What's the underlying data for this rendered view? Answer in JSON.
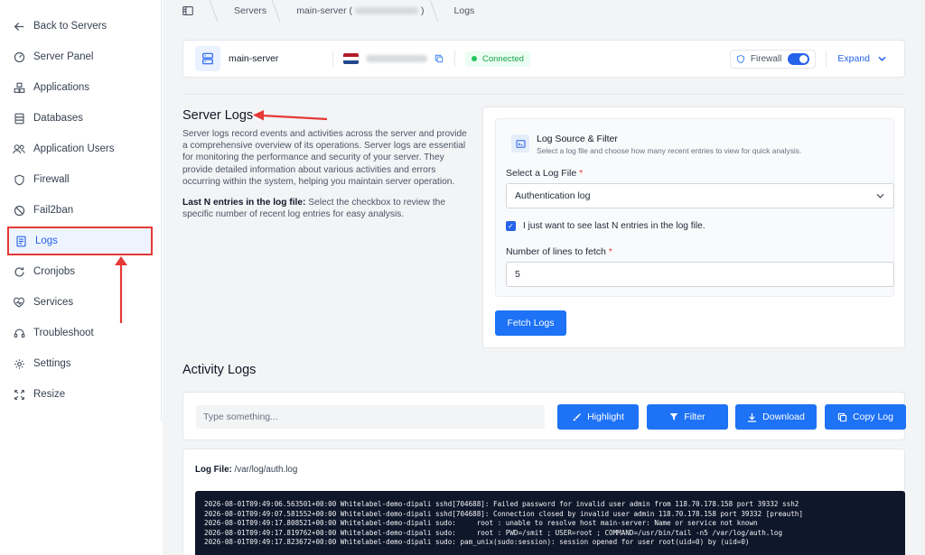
{
  "sidebar": {
    "back_label": "Back to Servers",
    "items": [
      {
        "label": "Server Panel",
        "icon": "gauge-icon"
      },
      {
        "label": "Applications",
        "icon": "applications-icon"
      },
      {
        "label": "Databases",
        "icon": "database-icon"
      },
      {
        "label": "Application Users",
        "icon": "users-icon"
      },
      {
        "label": "Firewall",
        "icon": "shield-icon"
      },
      {
        "label": "Fail2ban",
        "icon": "ban-icon"
      },
      {
        "label": "Logs",
        "icon": "logs-icon",
        "active": true
      },
      {
        "label": "Cronjobs",
        "icon": "refresh-icon"
      },
      {
        "label": "Services",
        "icon": "services-icon"
      },
      {
        "label": "Troubleshoot",
        "icon": "headset-icon"
      },
      {
        "label": "Settings",
        "icon": "gear-icon"
      },
      {
        "label": "Resize",
        "icon": "resize-icon"
      }
    ]
  },
  "breadcrumb": {
    "servers": "Servers",
    "server": "main-server (",
    "server_suffix": ")",
    "current": "Logs"
  },
  "server": {
    "name": "main-server",
    "status": "Connected",
    "firewall_label": "Firewall",
    "firewall_on": true,
    "expand_label": "Expand"
  },
  "intro": {
    "title": "Server Logs",
    "description": "Server logs record events and activities across the server and provide a comprehensive overview of its operations. Server logs are essential for monitoring the performance and security of your server. They provide detailed information about various activities and errors occurring within the system, helping you maintain server operation.",
    "lastn_title": "Last N entries in the log file:",
    "lastn_text": " Select the checkbox to review the specific number of recent log entries for easy analysis."
  },
  "filter": {
    "title": "Log Source & Filter",
    "subtitle": "Select a log file and choose how many recent entries to view for quick analysis.",
    "file_label": "Select a Log File",
    "file_value": "Authentication log",
    "checkbox_label": "I just want to see last N entries in the log file.",
    "checkbox_checked": true,
    "lines_label": "Number of lines to fetch",
    "lines_value": "5",
    "fetch_button": "Fetch Logs"
  },
  "activity": {
    "title": "Activity Logs",
    "search_placeholder": "Type something...",
    "highlight": "Highlight",
    "filter": "Filter",
    "download": "Download",
    "copy": "Copy Log",
    "logfile_label": "Log File:",
    "logfile_path": " /var/log/auth.log",
    "lines": [
      "2026-08-01T09:49:06.563501+00:00 Whitelabel-demo-dipali sshd[704688]: Failed password for invalid user admin from 118.70.178.158 port 39332 ssh2",
      "2026-08-01T09:49:07.581552+00:00 Whitelabel-demo-dipali sshd[704688]: Connection closed by invalid user admin 118.70.178.158 port 39332 [preauth]",
      "2026-08-01T09:49:17.808521+00:00 Whitelabel-demo-dipali sudo:     root : unable to resolve host main-server: Name or service not known",
      "2026-08-01T09:49:17.819762+00:00 Whitelabel-demo-dipali sudo:     root : PWD=/smit ; USER=root ; COMMAND=/usr/bin/tail -n5 /var/log/auth.log",
      "2026-08-01T09:49:17.823672+00:00 Whitelabel-demo-dipali sudo: pam_unix(sudo:session): session opened for user root(uid=0) by (uid=0)"
    ]
  },
  "colors": {
    "accent": "#1d72f5",
    "annotation": "#e53935",
    "connected": "#22c55e",
    "terminal_bg": "#0f172a"
  }
}
